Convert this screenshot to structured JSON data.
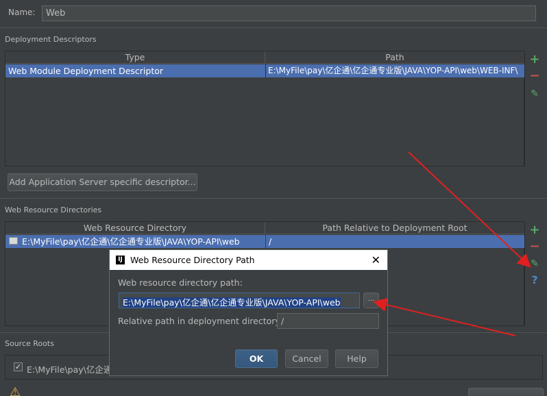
{
  "name_field": {
    "label": "Name:",
    "value": "Web"
  },
  "deployment_descriptors": {
    "title": "Deployment Descriptors",
    "columns": [
      "Type",
      "Path"
    ],
    "rows": [
      {
        "type": "Web Module Deployment Descriptor",
        "path": "E:\\MyFile\\pay\\亿企通\\亿企通专业版\\JAVA\\YOP-API\\web\\WEB-INF\\"
      }
    ],
    "add_button": "Add Application Server specific descriptor..."
  },
  "web_resource_directories": {
    "title": "Web Resource Directories",
    "columns": [
      "Web Resource Directory",
      "Path Relative to Deployment Root"
    ],
    "rows": [
      {
        "directory": "E:\\MyFile\\pay\\亿企通\\亿企通专业版\\JAVA\\YOP-API\\web",
        "relative": "/"
      }
    ]
  },
  "source_roots": {
    "title": "Source Roots",
    "items": [
      {
        "label": "E:\\MyFile\\pay\\亿企通",
        "checked": true
      }
    ]
  },
  "dialog": {
    "title": "Web Resource Directory Path",
    "path_label": "Web resource directory path:",
    "path_value": "E:\\MyFile\\pay\\亿企通\\亿企通专业版\\JAVA\\YOP-API\\web",
    "browse_label": "...",
    "relative_label": "Relative path in deployment directory:",
    "relative_value": "/",
    "ok": "OK",
    "cancel": "Cancel",
    "help": "Help"
  },
  "icons": [
    "add-icon",
    "remove-icon",
    "edit-icon",
    "help-icon",
    "warning-icon"
  ],
  "colors": {
    "selection": "#4b6eaf",
    "annotation_arrow": "#e02020",
    "add": "#59a869",
    "remove": "#c75450"
  }
}
